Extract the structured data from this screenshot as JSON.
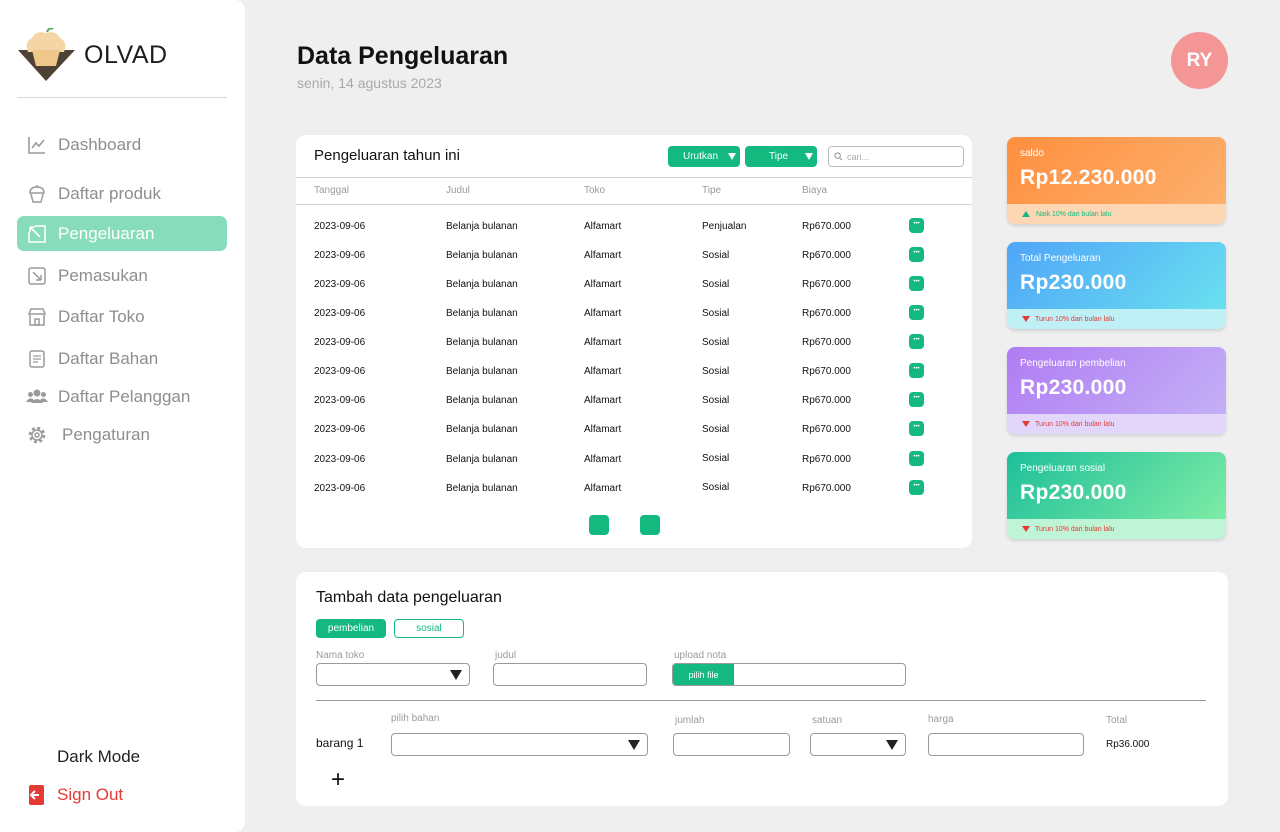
{
  "app": {
    "name": "OLVAD"
  },
  "sidebar": {
    "items": [
      {
        "label": "Dashboard",
        "icon": "chart-line-icon"
      },
      {
        "label": "Daftar produk",
        "icon": "cupcake-icon"
      },
      {
        "label": "Pengeluaran",
        "icon": "arrow-out-icon",
        "active": true
      },
      {
        "label": "Pemasukan",
        "icon": "arrow-in-icon"
      },
      {
        "label": "Daftar Toko",
        "icon": "store-icon"
      },
      {
        "label": "Daftar Bahan",
        "icon": "document-icon"
      },
      {
        "label": "Daftar Pelanggan",
        "icon": "users-icon"
      },
      {
        "label": "Pengaturan",
        "icon": "gear-icon"
      }
    ],
    "dark_mode_label": "Dark Mode",
    "sign_out_label": "Sign Out"
  },
  "header": {
    "title": "Data Pengeluaran",
    "date": "senin, 14 agustus 2023",
    "avatar_initials": "RY"
  },
  "table": {
    "title": "Pengeluaran tahun ini",
    "sort_label": "Urutkan",
    "type_label": "Tipe",
    "search_placeholder": "cari...",
    "columns": [
      "Tanggal",
      "Judul",
      "Toko",
      "Tipe",
      "Biaya"
    ],
    "rows": [
      [
        "2023-09-06",
        "Belanja bulanan",
        "Alfamart",
        "Penjualan",
        "Rp670.000"
      ],
      [
        "2023-09-06",
        "Belanja bulanan",
        "Alfamart",
        "Sosial",
        "Rp670.000"
      ],
      [
        "2023-09-06",
        "Belanja bulanan",
        "Alfamart",
        "Sosial",
        "Rp670.000"
      ],
      [
        "2023-09-06",
        "Belanja bulanan",
        "Alfamart",
        "Sosial",
        "Rp670.000"
      ],
      [
        "2023-09-06",
        "Belanja bulanan",
        "Alfamart",
        "Sosial",
        "Rp670.000"
      ],
      [
        "2023-09-06",
        "Belanja bulanan",
        "Alfamart",
        "Sosial",
        "Rp670.000"
      ],
      [
        "2023-09-06",
        "Belanja bulanan",
        "Alfamart",
        "Sosial",
        "Rp670.000"
      ],
      [
        "2023-09-06",
        "Belanja bulanan",
        "Alfamart",
        "Sosial",
        "Rp670.000"
      ],
      [
        "2023-09-06",
        "Belanja bulanan",
        "Alfamart",
        "Sosial",
        "Rp670.000"
      ],
      [
        "2023-09-06",
        "Belanja bulanan",
        "Alfamart",
        "Sosial",
        "Rp670.000"
      ]
    ]
  },
  "stats": [
    {
      "label": "saldo",
      "value": "Rp12.230.000",
      "note": "Naik 10% dari bulan lalu",
      "trend": "up",
      "gradient": [
        "#fe8f3f",
        "#fdb06d"
      ],
      "bottom": "#fdd7b4",
      "note_color": "#13b97f"
    },
    {
      "label": "Total Pengeluaran",
      "value": "Rp230.000",
      "note": "Turun 10% dari bulan lalu",
      "trend": "down",
      "gradient": [
        "#4fa5f7",
        "#6ae0f0"
      ],
      "bottom": "#bff0f6",
      "note_color": "#e53935"
    },
    {
      "label": "Pengeluaran pembelian",
      "value": "Rp230.000",
      "note": "Turun 10% dari bulan lalu",
      "trend": "down",
      "gradient": [
        "#b07cf3",
        "#c4b0f6"
      ],
      "bottom": "#e3d6fb",
      "note_color": "#e53935"
    },
    {
      "label": "Pengeluaran sosial",
      "value": "Rp230.000",
      "note": "Turun 10% dari bulan lalu",
      "trend": "down",
      "gradient": [
        "#1fbf9a",
        "#7deca6"
      ],
      "bottom": "#bff4d6",
      "note_color": "#e53935"
    }
  ],
  "form": {
    "title": "Tambah data pengeluaran",
    "tab_pembelian": "pembelian",
    "tab_sosial": "sosial",
    "store_label": "Nama toko",
    "title_label": "judul",
    "upload_label": "upload nota",
    "choose_file": "pilih file",
    "item_label": "barang 1",
    "ingredient_label": "pilih bahan",
    "qty_label": "jumlah",
    "unit_label": "satuan",
    "price_label": "harga",
    "total_label": "Total",
    "total_value": "Rp36.000",
    "add_symbol": "+"
  },
  "colors": {
    "accent": "#13b97f",
    "active_nav": "#86dcbb",
    "avatar": "#f49696",
    "sign_out": "#e53935"
  }
}
